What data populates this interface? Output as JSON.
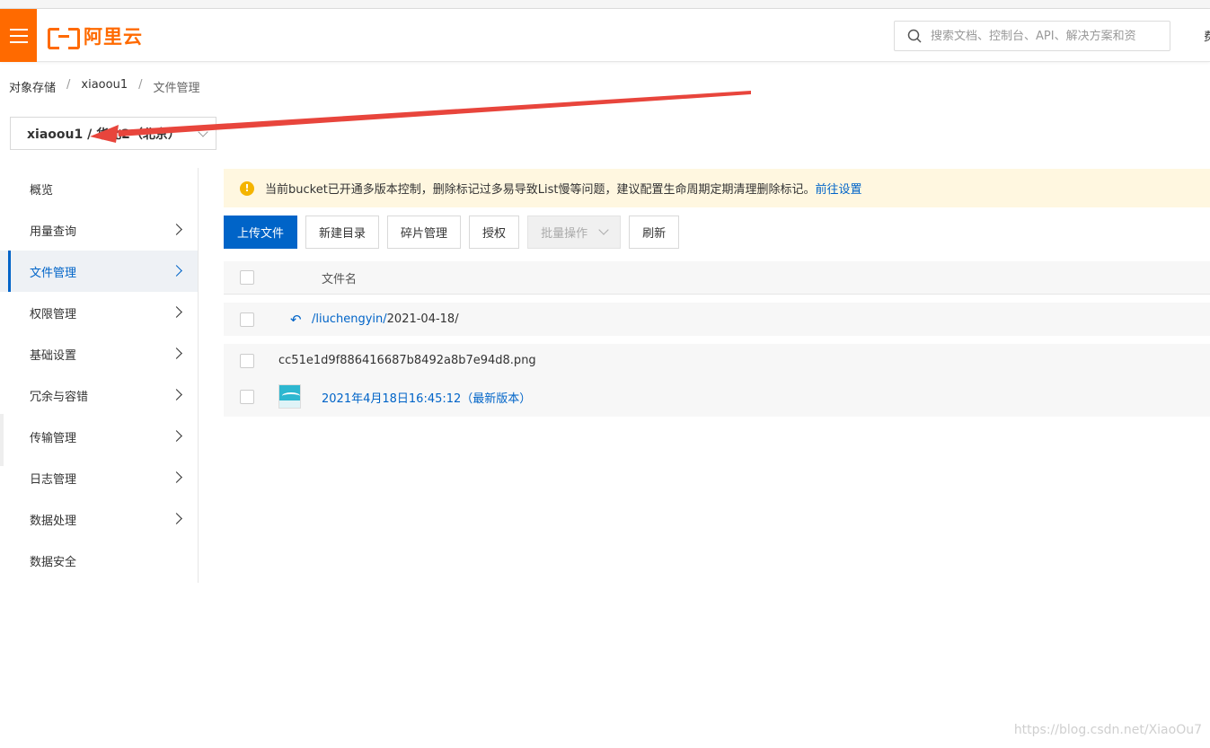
{
  "header": {
    "logo_text": "阿里云",
    "search_placeholder": "搜索文档、控制台、API、解决方案和资",
    "right_text": "费"
  },
  "breadcrumb": {
    "items": [
      "对象存储",
      "xiaoou1",
      "文件管理"
    ],
    "separator": "/"
  },
  "bucket_selector": {
    "value": "xiaoou1 / 华北2（北京）"
  },
  "sidebar": {
    "items": [
      {
        "label": "概览",
        "has_arrow": false
      },
      {
        "label": "用量查询",
        "has_arrow": true
      },
      {
        "label": "文件管理",
        "has_arrow": true,
        "active": true
      },
      {
        "label": "权限管理",
        "has_arrow": true
      },
      {
        "label": "基础设置",
        "has_arrow": true
      },
      {
        "label": "冗余与容错",
        "has_arrow": true
      },
      {
        "label": "传输管理",
        "has_arrow": true
      },
      {
        "label": "日志管理",
        "has_arrow": true
      },
      {
        "label": "数据处理",
        "has_arrow": true
      },
      {
        "label": "数据安全",
        "has_arrow": false
      }
    ]
  },
  "notice": {
    "text": "当前bucket已开通多版本控制，删除标记过多易导致List慢等问题，建议配置生命周期定期清理删除标记。",
    "link": "前往设置"
  },
  "toolbar": {
    "upload": "上传文件",
    "new_dir": "新建目录",
    "fragments": "碎片管理",
    "authorize": "授权",
    "batch": "批量操作",
    "refresh": "刷新"
  },
  "table": {
    "header_filename": "文件名",
    "dir_prefix": "/liuchengyin/",
    "dir_current": "2021-04-18/",
    "file_name": "cc51e1d9f886416687b8492a8b7e94d8.png",
    "version_label": "2021年4月18日16:45:12（最新版本）"
  },
  "watermark": "https://blog.csdn.net/XiaoOu7",
  "colors": {
    "brand": "#ff6a00",
    "primary": "#0064c8",
    "notice_bg": "#fff7e0",
    "annotation": "#e8453c"
  }
}
